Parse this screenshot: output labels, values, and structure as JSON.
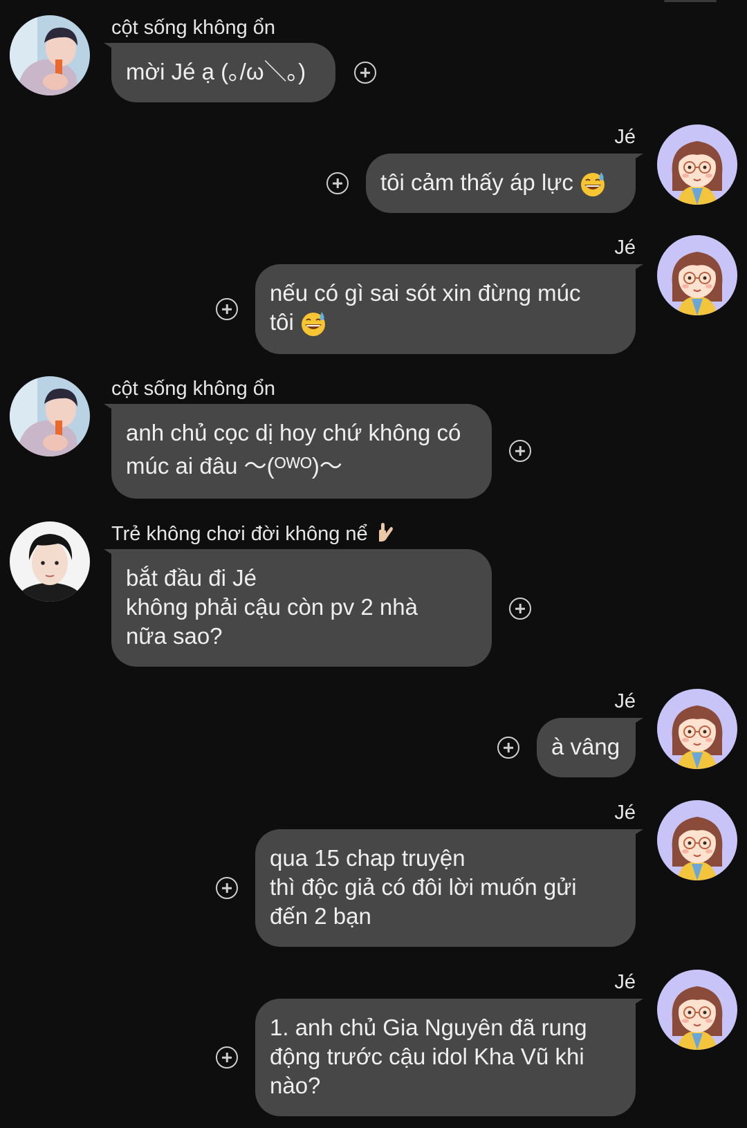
{
  "messages": [
    {
      "sender": "cột sống không ổn",
      "lines": [
        "mời Jé ạ (｡/ω＼｡)"
      ]
    },
    {
      "sender": "Jé",
      "lines": [
        "tôi cảm thấy áp lực"
      ],
      "emoji": "grinning-sweat-emoji"
    },
    {
      "sender": "Jé",
      "lines": [
        "nếu có gì sai sót xin đừng múc",
        "tôi"
      ],
      "emoji": "grinning-sweat-emoji"
    },
    {
      "sender": "cột sống không ổn",
      "lines": [
        "anh chủ cọc dị hoy chứ không có",
        "múc ai đâu ～(ᴼᵂᴼ)～"
      ]
    },
    {
      "sender": "Trẻ không chơi đời không nể",
      "sender_emoji": "rock-on-hand-emoji",
      "lines": [
        "bắt đầu đi Jé",
        "không phải cậu còn pv 2 nhà",
        "nữa sao?"
      ]
    },
    {
      "sender": "Jé",
      "lines": [
        "à vâng"
      ]
    },
    {
      "sender": "Jé",
      "lines": [
        "qua 15 chap truyện",
        "thì độc giả có đôi lời muốn gửi",
        "đến 2 bạn"
      ]
    },
    {
      "sender": "Jé",
      "lines": [
        "1. anh chủ Gia Nguyên đã rung",
        "động trước cậu idol Kha Vũ khi",
        "nào?"
      ]
    }
  ],
  "colors": {
    "background": "#0e0e0e",
    "bubble": "#474747",
    "text": "#efefef",
    "avatar_bg_girl": "#c9c4f7"
  },
  "icons": {
    "reaction": "add-reaction-icon",
    "avatar_girl": "cartoon-girl-avatar",
    "avatar_user1": "user-photo-avatar",
    "avatar_user2": "user-photo-avatar"
  }
}
